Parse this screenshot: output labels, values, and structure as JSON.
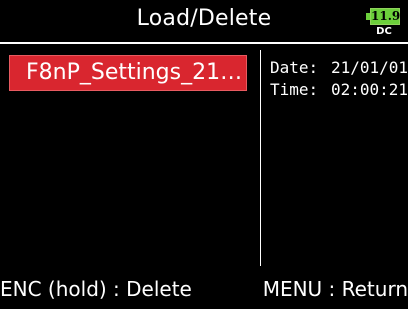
{
  "header": {
    "title": "Load/Delete"
  },
  "battery": {
    "level_text": "11.9",
    "source_label": "DC",
    "color": "#6ccf3b"
  },
  "file_list": {
    "selected_item": "F8nP_Settings_21…",
    "highlight_color": "#d9262f"
  },
  "file_info": {
    "date_label": "Date:",
    "date_value": "21/01/01",
    "time_label": "Time:",
    "time_value": "02:00:21"
  },
  "footer": {
    "left_hint": "ENC (hold) : Delete",
    "right_hint": "MENU : Return"
  }
}
